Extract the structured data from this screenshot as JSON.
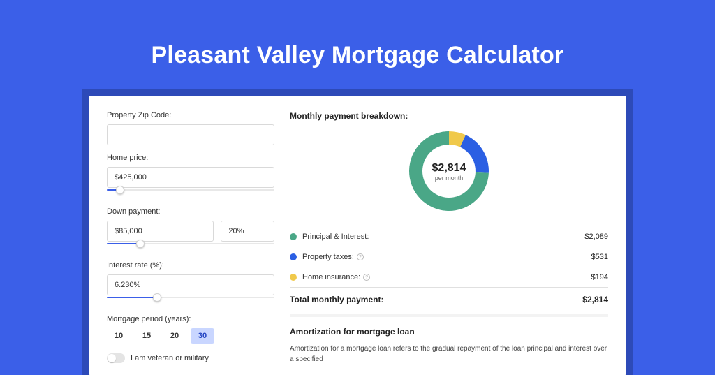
{
  "title": "Pleasant Valley Mortgage Calculator",
  "form": {
    "zip_label": "Property Zip Code:",
    "zip_value": "",
    "price_label": "Home price:",
    "price_value": "$425,000",
    "price_slider_pct": 8,
    "down_label": "Down payment:",
    "down_value": "$85,000",
    "down_pct": "20%",
    "down_slider_pct": 20,
    "rate_label": "Interest rate (%):",
    "rate_value": "6.230%",
    "rate_slider_pct": 30,
    "period_label": "Mortgage period (years):",
    "periods": [
      "10",
      "15",
      "20",
      "30"
    ],
    "period_active_index": 3,
    "veteran_label": "I am veteran or military"
  },
  "breakdown": {
    "title": "Monthly payment breakdown:",
    "center_amount": "$2,814",
    "center_sub": "per month",
    "items": [
      {
        "label": "Principal & Interest:",
        "value": "$2,089",
        "color": "#4aa787",
        "info": false,
        "num": 2089
      },
      {
        "label": "Property taxes:",
        "value": "$531",
        "color": "#2b5fe3",
        "info": true,
        "num": 531
      },
      {
        "label": "Home insurance:",
        "value": "$194",
        "color": "#f0c94b",
        "info": true,
        "num": 194
      }
    ],
    "total_label": "Total monthly payment:",
    "total_value": "$2,814"
  },
  "amort": {
    "title": "Amortization for mortgage loan",
    "text": "Amortization for a mortgage loan refers to the gradual repayment of the loan principal and interest over a specified"
  },
  "chart_data": {
    "type": "pie",
    "title": "Monthly payment breakdown",
    "series": [
      {
        "name": "Principal & Interest",
        "value": 2089,
        "color": "#4aa787"
      },
      {
        "name": "Property taxes",
        "value": 531,
        "color": "#2b5fe3"
      },
      {
        "name": "Home insurance",
        "value": 194,
        "color": "#f0c94b"
      }
    ],
    "total": 2814,
    "center_label": "$2,814 per month"
  }
}
